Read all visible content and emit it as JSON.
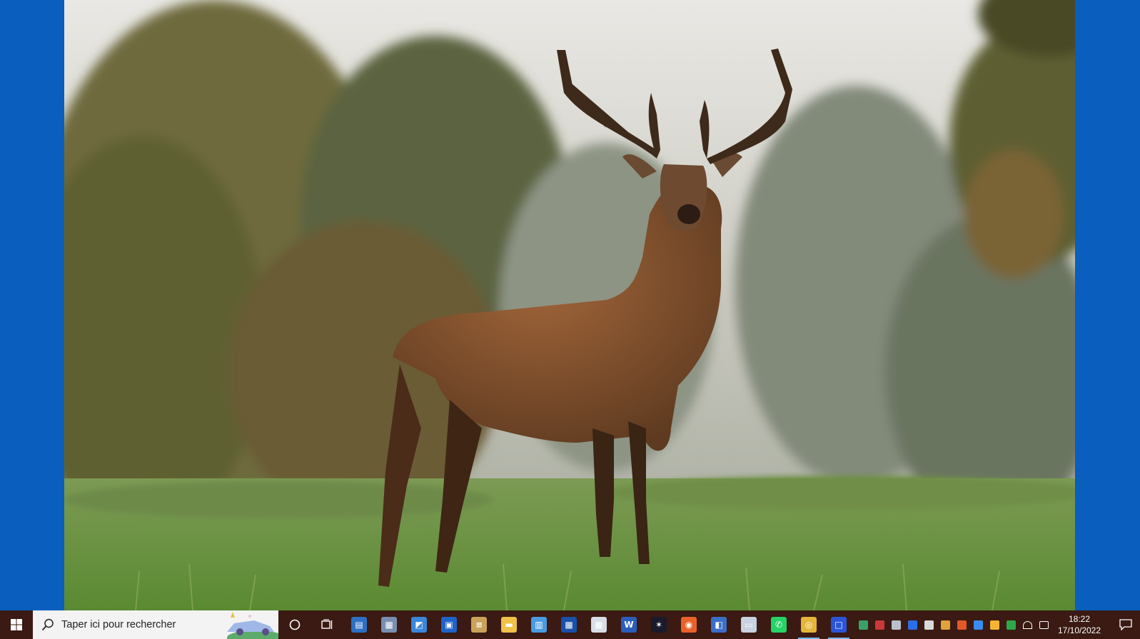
{
  "taskbar": {
    "search_placeholder": "Taper ici pour rechercher",
    "clock": {
      "time": "18:22",
      "date": "17/10/2022"
    },
    "pinned_apps": [
      {
        "name": "taskbar-app-control-panel",
        "icon": "window-icon",
        "color": "#2d6fc4",
        "glyph": "▤"
      },
      {
        "name": "taskbar-app-files",
        "icon": "cabinet-icon",
        "color": "#7a8fb0",
        "glyph": "▦"
      },
      {
        "name": "taskbar-app-laptop",
        "icon": "laptop-icon",
        "color": "#3a86d8",
        "glyph": "◩"
      },
      {
        "name": "taskbar-app-calendar",
        "icon": "calendar-icon",
        "color": "#1f63c8",
        "glyph": "▣"
      },
      {
        "name": "taskbar-app-books",
        "icon": "books-icon",
        "color": "#c9a35a",
        "glyph": "≡"
      },
      {
        "name": "taskbar-app-file-explorer",
        "icon": "folder-icon",
        "color": "#f0c24a",
        "glyph": "▬"
      },
      {
        "name": "taskbar-app-news",
        "icon": "news-icon",
        "color": "#4a9be0",
        "glyph": "▥"
      },
      {
        "name": "taskbar-app-chip",
        "icon": "chip-icon",
        "color": "#1b4fa8",
        "glyph": "▩"
      },
      {
        "name": "taskbar-app-calculator",
        "icon": "calculator-icon",
        "color": "#d8dde6",
        "glyph": "▦"
      },
      {
        "name": "taskbar-app-word",
        "icon": "word-icon",
        "color": "#2b5eb8",
        "glyph": "W"
      },
      {
        "name": "taskbar-app-photo-editor",
        "icon": "sparkle-icon",
        "color": "#1a1a2a",
        "glyph": "✶"
      },
      {
        "name": "taskbar-app-firefox",
        "icon": "firefox-icon",
        "color": "#e8622a",
        "glyph": "◉"
      },
      {
        "name": "taskbar-app-remote",
        "icon": "monitor-icon",
        "color": "#3a6fc8",
        "glyph": "◧"
      },
      {
        "name": "taskbar-app-display",
        "icon": "screen-icon",
        "color": "#c8d2e0",
        "glyph": "▭"
      },
      {
        "name": "taskbar-app-whatsapp",
        "icon": "whatsapp-icon",
        "color": "#25d366",
        "glyph": "✆"
      },
      {
        "name": "taskbar-app-chrome",
        "icon": "chrome-icon",
        "color": "#e3b53a",
        "glyph": "◎",
        "active": true
      },
      {
        "name": "taskbar-app-window-manager",
        "icon": "window-manager-icon",
        "color": "#2a55d8",
        "glyph": "□",
        "active": true
      }
    ],
    "tray_icons": [
      {
        "name": "tray-security-icon",
        "color": "#3aa06a"
      },
      {
        "name": "tray-display-icon",
        "color": "#c83a3a"
      },
      {
        "name": "tray-network-card-icon",
        "color": "#b9c2cc"
      },
      {
        "name": "tray-malwarebytes-icon",
        "color": "#2a6ee8"
      },
      {
        "name": "tray-usb-icon",
        "color": "#d9d9d9"
      },
      {
        "name": "tray-drive-icon",
        "color": "#e0a33a"
      },
      {
        "name": "tray-onedrive-icon",
        "color": "#e25a2a"
      },
      {
        "name": "tray-bluetooth-icon",
        "color": "#3b8cf0"
      },
      {
        "name": "tray-update-icon",
        "color": "#f2b632"
      },
      {
        "name": "tray-defender-icon",
        "color": "#2fa84a"
      },
      {
        "name": "tray-wifi-icon",
        "color": "#ffffff"
      },
      {
        "name": "tray-volume-icon",
        "color": "#ffffff"
      }
    ]
  }
}
